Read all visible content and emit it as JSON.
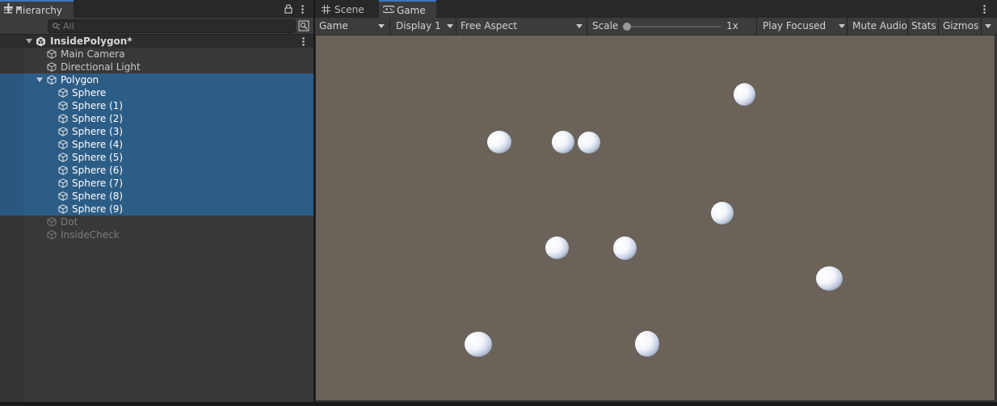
{
  "hierarchy": {
    "tab_label": "Hierarchy",
    "search_placeholder": "All",
    "scene_name": "InsidePolygon*",
    "items": [
      {
        "label": "Main Camera"
      },
      {
        "label": "Directional Light"
      },
      {
        "label": "Polygon"
      },
      {
        "label": "Sphere"
      },
      {
        "label": "Sphere (1)"
      },
      {
        "label": "Sphere (2)"
      },
      {
        "label": "Sphere (3)"
      },
      {
        "label": "Sphere (4)"
      },
      {
        "label": "Sphere (5)"
      },
      {
        "label": "Sphere (6)"
      },
      {
        "label": "Sphere (7)"
      },
      {
        "label": "Sphere (8)"
      },
      {
        "label": "Sphere (9)"
      },
      {
        "label": "Dot"
      },
      {
        "label": "InsideCheck"
      }
    ]
  },
  "game_view": {
    "tabs": [
      {
        "label": "Scene"
      },
      {
        "label": "Game"
      }
    ],
    "toolbar": {
      "view_mode": "Game",
      "display": "Display 1",
      "aspect": "Free Aspect",
      "scale_label": "Scale",
      "scale_value": "1x",
      "play_mode": "Play Focused",
      "mute_audio": "Mute Audio",
      "stats": "Stats",
      "gizmos": "Gizmos"
    }
  },
  "colors": {
    "selection": "#2c5d87",
    "viewport_background": "#6b625a",
    "tab_accent": "#3a79bb"
  }
}
